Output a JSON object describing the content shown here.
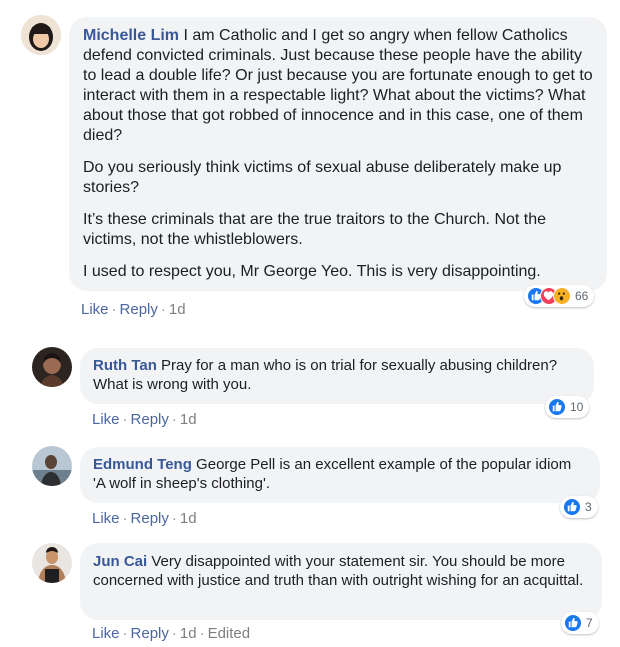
{
  "comments": [
    {
      "author": "Michelle Lim",
      "text": " I am Catholic and I get so angry when fellow Catholics defend convicted criminals. Just because these people have the ability to lead a double life? Or just because you are fortunate enough to get to interact with them in a respectable light? What about the victims? What about those that got robbed of innocence and in this case, one of them died?",
      "paragraphs": [
        "Do you seriously think victims of sexual abuse deliberately make up stories?",
        "It’s these criminals that are the true traitors to the Church. Not the victims, not the whistleblowers.",
        "I used to respect you, Mr George Yeo. This is very disappointing."
      ],
      "like_label": "Like",
      "reply_label": "Reply",
      "time": "1d",
      "reaction_count": "66",
      "reaction_icons": [
        "like-icon",
        "love-icon",
        "wow-icon"
      ]
    },
    {
      "author": "Ruth Tan",
      "text": " Pray for a man who is on trial for sexually abusing children? What is wrong with you.",
      "like_label": "Like",
      "reply_label": "Reply",
      "time": "1d",
      "reaction_count": "10",
      "reaction_icons": [
        "like-icon"
      ]
    },
    {
      "author": "Edmund Teng",
      "text": " George Pell is an excellent example of the popular idiom 'A wolf in sheep's clothing'.",
      "like_label": "Like",
      "reply_label": "Reply",
      "time": "1d",
      "reaction_count": "3",
      "reaction_icons": [
        "like-icon"
      ]
    },
    {
      "author": "Jun Cai",
      "text": " Very disappointed with your statement sir. You should be more concerned with justice and truth than with outright wishing for an acquittal.",
      "like_label": "Like",
      "reply_label": "Reply",
      "time": "1d",
      "edited_label": "Edited",
      "reaction_count": "7",
      "reaction_icons": [
        "like-icon"
      ]
    }
  ],
  "colors": {
    "name": "#385898",
    "bubble": "#f2f3f5",
    "like_blue": "#1877f2",
    "love_red": "#f33e58",
    "wow_yellow": "#f7b125"
  }
}
